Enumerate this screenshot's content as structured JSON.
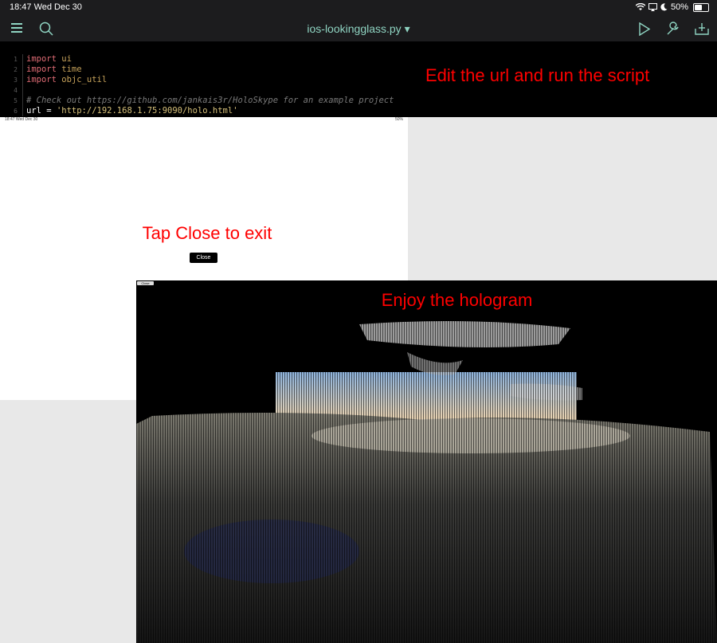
{
  "status_bar": {
    "time": "18:47  Wed Dec 30",
    "battery": "50%"
  },
  "toolbar": {
    "file_title": "ios-lookingglass.py ▾"
  },
  "code": [
    {
      "num": "1",
      "kw": "import",
      "rest": " ui"
    },
    {
      "num": "2",
      "kw": "import",
      "rest": " time"
    },
    {
      "num": "3",
      "kw": "import",
      "rest": " objc_util"
    },
    {
      "num": "4",
      "kw": "",
      "rest": ""
    },
    {
      "num": "5",
      "comment": "# Check out https://github.com/jankais3r/HoloSkype for an example project"
    },
    {
      "num": "6",
      "plain": "url = ",
      "str": "'http://192.168.1.75:9090/holo.html'"
    }
  ],
  "annotations": {
    "editor": "Edit the url and run the script",
    "webview": "Tap Close to exit",
    "hologram": "Enjoy the hologram"
  },
  "webview": {
    "mini_status": "18:47  Wed Dec 30",
    "mini_status_right": "50%",
    "close_label": "Close"
  },
  "hologram": {
    "close_label": "Close"
  },
  "colors": {
    "annotation": "#ff0000",
    "accent": "#8fd4c2",
    "editor_bg": "#000000"
  }
}
